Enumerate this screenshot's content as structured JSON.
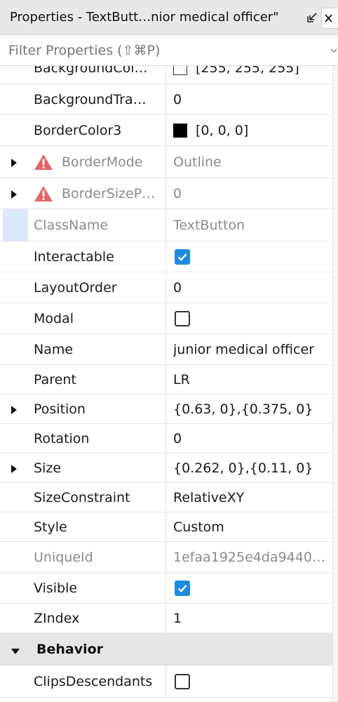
{
  "window": {
    "title": "Properties - TextButt…nior medical officer\"",
    "undock_icon": "undock-icon",
    "close_icon": "close-icon"
  },
  "filter": {
    "placeholder": "Filter Properties (⇧⌘P)"
  },
  "properties": [
    {
      "name": "BackgroundCol…",
      "value": "[255, 255, 255]",
      "swatch": "#ffffff"
    },
    {
      "name": "BackgroundTra…",
      "value": "0"
    },
    {
      "name": "BorderColor3",
      "value": "[0, 0, 0]",
      "swatch": "#000000"
    },
    {
      "name": "BorderMode",
      "value": "Outline",
      "warning": true,
      "expandable": true,
      "muted": true
    },
    {
      "name": "BorderSizeP…",
      "value": "0",
      "warning": true,
      "expandable": true,
      "muted": true
    },
    {
      "name": "ClassName",
      "value": "TextButton",
      "muted": true,
      "selected": true
    },
    {
      "name": "Interactable",
      "checkbox": true
    },
    {
      "name": "LayoutOrder",
      "value": "0"
    },
    {
      "name": "Modal",
      "checkbox": false
    },
    {
      "name": "Name",
      "value": "junior medical officer"
    },
    {
      "name": "Parent",
      "value": "LR"
    },
    {
      "name": "Position",
      "value": "{0.63, 0},{0.375, 0}",
      "expandable": true
    },
    {
      "name": "Rotation",
      "value": "0"
    },
    {
      "name": "Size",
      "value": "{0.262, 0},{0.11, 0}",
      "expandable": true
    },
    {
      "name": "SizeConstraint",
      "value": "RelativeXY"
    },
    {
      "name": "Style",
      "value": "Custom"
    },
    {
      "name": "UniqueId",
      "value": "1efaa1925e4da9440…",
      "muted": true
    },
    {
      "name": "Visible",
      "checkbox": true
    },
    {
      "name": "ZIndex",
      "value": "1"
    }
  ],
  "sections": [
    {
      "label": "Behavior"
    }
  ],
  "behavior_properties": [
    {
      "name": "ClipsDescendants",
      "checkbox": false
    }
  ]
}
